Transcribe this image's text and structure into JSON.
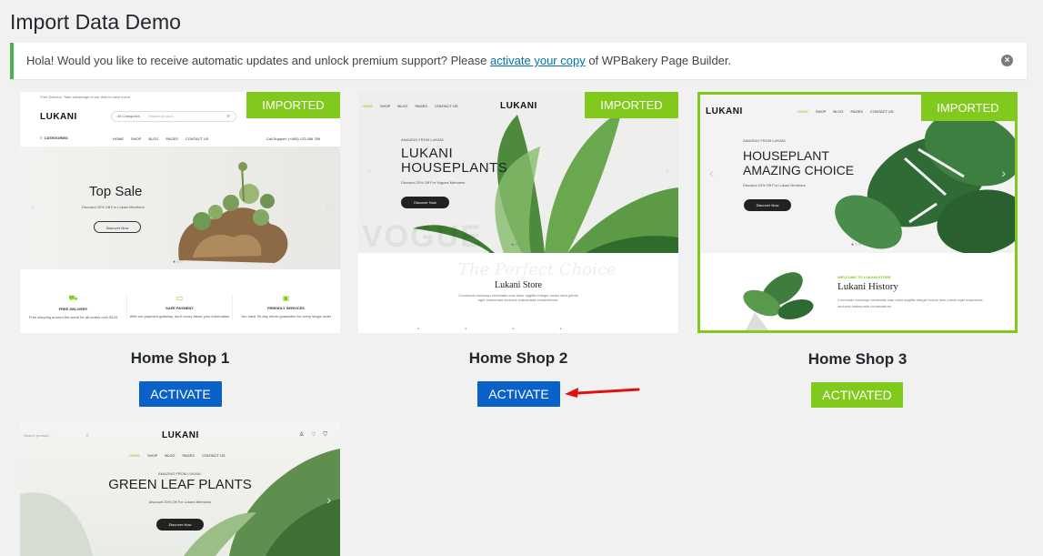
{
  "page": {
    "title": "Import Data Demo"
  },
  "notice": {
    "text_before": "Hola! Would you like to receive automatic updates and unlock premium support? Please ",
    "link": "activate your copy",
    "text_after": " of WPBakery Page Builder.",
    "close_icon": "×"
  },
  "colors": {
    "accent_green": "#81c91c",
    "button_blue": "#0a62c9",
    "notice_border": "#46b450"
  },
  "demos": [
    {
      "title": "Home Shop 1",
      "badge": "IMPORTED",
      "button": "ACTIVATE",
      "mock": {
        "topbar": "Free Delivery: Take advantage of our time to save event",
        "logo": "LUKANI",
        "categories": "All Categories",
        "search_placeholder": "Search product...",
        "categories_label": "CATEGORIES",
        "nav": [
          "HOME",
          "SHOP",
          "BLOG",
          "PAGES",
          "CONTACT US"
        ],
        "call": "Call Support: (+800) 123 456 789",
        "hero_title": "Top Sale",
        "hero_sub": "Discount 20% Off For Lukani Members",
        "hero_btn": "Discover Now",
        "features": [
          {
            "title": "FREE DELIVERY",
            "text": "Free shipping around the world for all orders over $120"
          },
          {
            "title": "SAFE PAYMENT",
            "text": "With our payment gateway, don't worry about your information"
          },
          {
            "title": "FRIENDLY SERVICES",
            "text": "You have 30-day return guarantee for every single order"
          }
        ]
      }
    },
    {
      "title": "Home Shop 2",
      "badge": "IMPORTED",
      "button": "ACTIVATE",
      "mock": {
        "nav": [
          "HOME",
          "SHOP",
          "BLOG",
          "PAGES",
          "CONTACT US"
        ],
        "logo": "LUKANI",
        "kicker": "AMAZING FROM LUKANI",
        "hero_line1": "LUKANI",
        "hero_line2": "HOUSEPLANTS",
        "hero_sub": "Discount 20% Off For Vogues Members",
        "hero_btn": "Discover Now",
        "watermark": "VOGUE",
        "section_title": "Lukani Store",
        "script": "The Perfect Choice",
        "section_text": "Commodo sociosqu venenatis cras dolor sagittis integer luctus sem primis eget maecenas sedurna malesuada consectetuer."
      }
    },
    {
      "title": "Home Shop 3",
      "badge": "IMPORTED",
      "button": "ACTIVATED",
      "mock": {
        "logo": "LUKANI",
        "nav": [
          "HOME",
          "SHOP",
          "BLOG",
          "PAGES",
          "CONTACT US"
        ],
        "kicker": "AMAZING FROM LUKANI",
        "hero_line1": "HOUSEPLANT",
        "hero_line2": "AMAZING CHOICE",
        "hero_sub": "Discount 20% Off For Lukani Members",
        "hero_btn": "Discover Now",
        "welcome": "WELCOME TO LUKANI STORE",
        "section_title": "Lukani History",
        "section_text": "Commodo sociosqu venenatis cras dolor sagittis integer luctus sem primis eget maecenas sedurna malesuada consectetuer."
      }
    },
    {
      "mock": {
        "search_placeholder": "Search product...",
        "logo": "LUKANI",
        "nav": [
          "HOME",
          "SHOP",
          "BLOG",
          "PAGES",
          "CONTACT US"
        ],
        "kicker": "AMAZING FROM LUKANI",
        "hero_title": "GREEN LEAF PLANTS",
        "hero_sub": "Discount 20% Off For Lukani Members",
        "hero_btn": "Discover Now"
      }
    }
  ]
}
